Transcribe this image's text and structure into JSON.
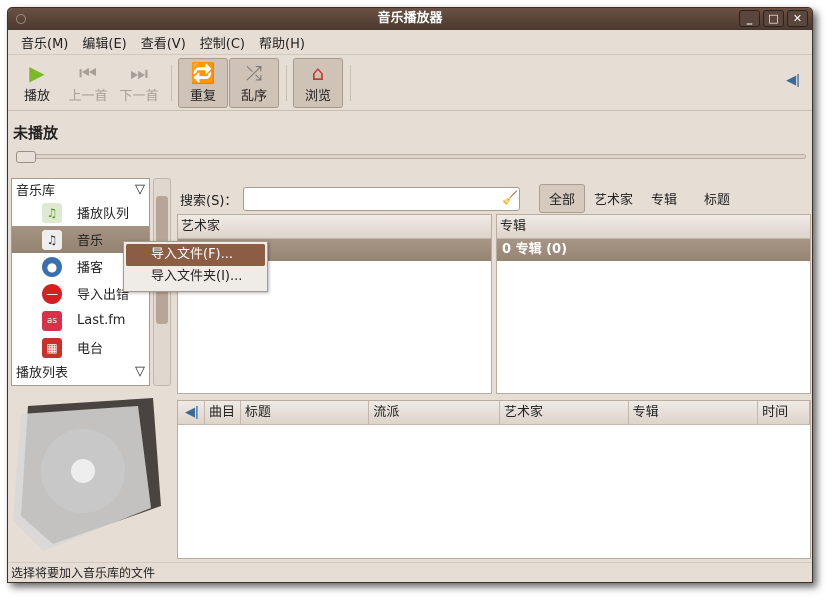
{
  "window": {
    "title": "音乐播放器"
  },
  "menu": [
    "音乐(M)",
    "编辑(E)",
    "查看(V)",
    "控制(C)",
    "帮助(H)"
  ],
  "toolbar": {
    "play": "播放",
    "prev": "上一首",
    "next": "下一首",
    "repeat": "重复",
    "shuffle": "乱序",
    "browse": "浏览"
  },
  "now_playing": "未播放",
  "sidebar": {
    "library_header": "音乐库",
    "items": [
      {
        "label": "播放队列",
        "icon": "queue-icon"
      },
      {
        "label": "音乐",
        "icon": "music-icon"
      },
      {
        "label": "播客",
        "icon": "podcast-icon"
      },
      {
        "label": "导入出错",
        "icon": "error-icon"
      },
      {
        "label": "Last.fm",
        "icon": "lastfm-icon"
      },
      {
        "label": "电台",
        "icon": "radio-icon"
      }
    ],
    "playlists_header": "播放列表"
  },
  "search": {
    "label": "搜索(S)：",
    "value": ""
  },
  "filters": [
    "全部",
    "艺术家",
    "专辑",
    "标题"
  ],
  "artist_pane": {
    "header": "艺术家"
  },
  "album_pane": {
    "header": "专辑",
    "row": "0 专辑 (0)"
  },
  "tracks": {
    "columns": [
      "曲目",
      "标题",
      "流派",
      "艺术家",
      "专辑",
      "时间"
    ]
  },
  "context_menu": [
    "导入文件(F)...",
    "导入文件夹(I)..."
  ],
  "statusbar": "选择将要加入音乐库的文件"
}
